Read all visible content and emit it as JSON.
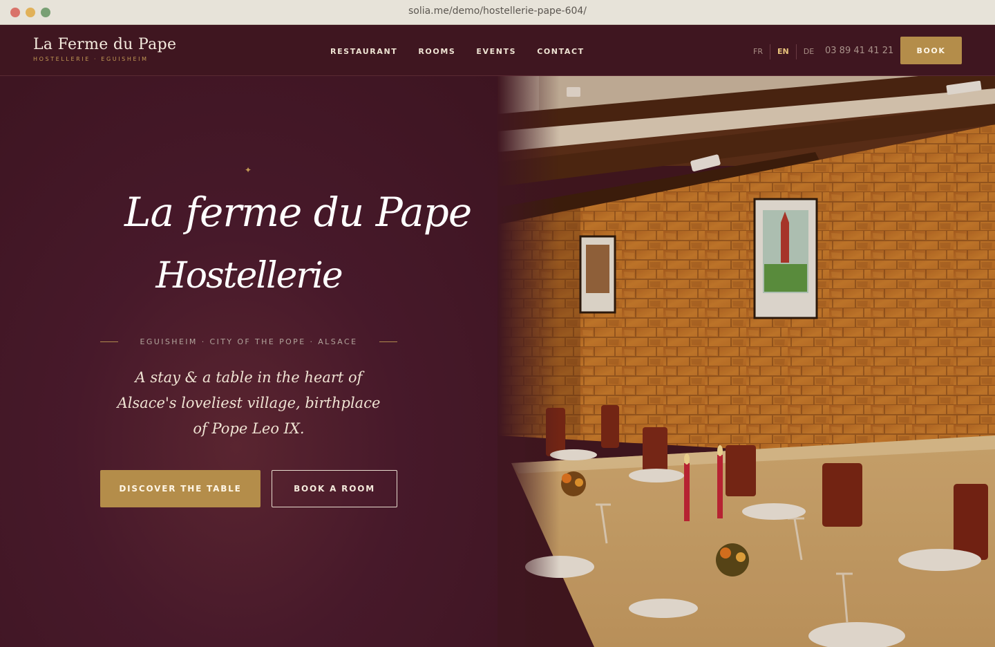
{
  "browser": {
    "url": "solia.me/demo/hostellerie-pape-604/"
  },
  "header": {
    "brand_name": "La Ferme du Pape",
    "brand_sub": "HOSTELLERIE · EGUISHEIM",
    "nav": [
      "RESTAURANT",
      "ROOMS",
      "EVENTS",
      "CONTACT"
    ],
    "languages": [
      "FR",
      "EN",
      "DE"
    ],
    "active_language": "EN",
    "phone": "03 89 41 41 21",
    "book_label": "BOOK"
  },
  "hero": {
    "sparkle": "✦",
    "script_line1": "La ferme du Pape",
    "script_line2": "Hostellerie",
    "tagline": "EGUISHEIM · CITY OF THE POPE · ALSACE",
    "lead": "A stay & a table in the heart of Alsace's loveliest village, birthplace of Pope Leo IX.",
    "primary_cta": "DISCOVER THE TABLE",
    "secondary_cta": "BOOK A ROOM"
  },
  "colors": {
    "background": "#3f1620",
    "accent_gold": "#b48d4a",
    "text_cream": "#efe3d3"
  }
}
